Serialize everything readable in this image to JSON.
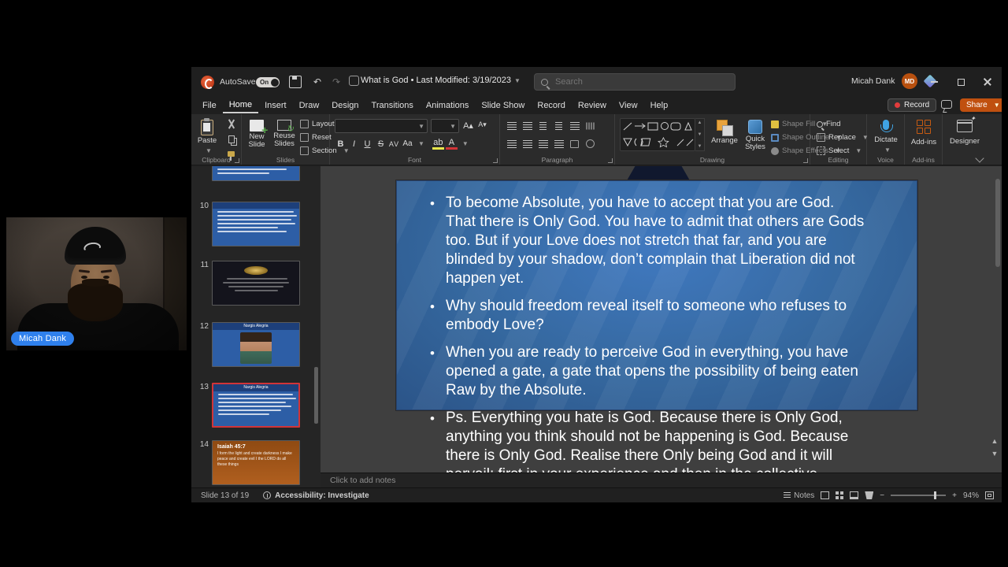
{
  "webcam": {
    "name_tag": "Micah Dank"
  },
  "titlebar": {
    "autosave_label": "AutoSave",
    "autosave_state": "On",
    "title": "What is God • Last Modified: 3/19/2023",
    "search_placeholder": "Search",
    "user_name": "Micah Dank",
    "user_initials": "MD"
  },
  "menubar": {
    "tabs": [
      "File",
      "Home",
      "Insert",
      "Draw",
      "Design",
      "Transitions",
      "Animations",
      "Slide Show",
      "Record",
      "Review",
      "View",
      "Help"
    ],
    "record_button": "Record",
    "share_button": "Share"
  },
  "ribbon": {
    "clipboard": {
      "label": "Clipboard",
      "paste": "Paste"
    },
    "slides": {
      "label": "Slides",
      "new_1": "New",
      "new_2": "Slide",
      "reuse_1": "Reuse",
      "reuse_2": "Slides",
      "layout": "Layout",
      "reset": "Reset",
      "section": "Section"
    },
    "font": {
      "label": "Font",
      "bold": "B",
      "italic": "I",
      "underline": "U",
      "strike": "S",
      "spacing": "AV",
      "case": "Aa",
      "font_name_value": "",
      "font_size_value": ""
    },
    "paragraph": {
      "label": "Paragraph"
    },
    "drawing": {
      "label": "Drawing",
      "arrange": "Arrange",
      "quick_1": "Quick",
      "quick_2": "Styles",
      "shape_fill": "Shape Fill",
      "shape_outline": "Shape Outline",
      "shape_effects": "Shape Effects"
    },
    "editing": {
      "label": "Editing",
      "find": "Find",
      "replace": "Replace",
      "select": "Select"
    },
    "voice": {
      "label": "Voice",
      "dictate": "Dictate"
    },
    "addins": {
      "label": "Add-ins",
      "button": "Add-ins"
    },
    "designer": {
      "label": "Designer"
    }
  },
  "thumbnails": {
    "items": [
      {
        "number": "10"
      },
      {
        "number": "11"
      },
      {
        "number": "12",
        "header": "Nargis Alegria"
      },
      {
        "number": "13",
        "header": "Nargis Alegria"
      },
      {
        "number": "14",
        "title": "Isaiah 45:7",
        "body": "I form the light and create darkness I make peace and create evil I the LORD do all these things"
      }
    ]
  },
  "slide": {
    "bullets": [
      "To become Absolute, you have to accept that you are God. That there is Only God. You have to admit that others are Gods too. But if your Love does not stretch that far, and you are blinded by your shadow, don’t complain that Liberation did not happen yet.",
      "Why should freedom reveal itself to someone who refuses to embody Love?",
      "When you are ready to perceive God in everything, you have opened a gate, a gate that opens the possibility of being eaten Raw by the Absolute.",
      "Ps. Everything you hate is God. Because there is Only God, anything you think should not be happening is God. Because there is Only God. Realise there Only being God and it will pervail; first in your experience and then in the collective."
    ]
  },
  "notes": {
    "placeholder": "Click to add notes"
  },
  "statusbar": {
    "slide_indicator": "Slide 13 of 19",
    "accessibility": "Accessibility: Investigate",
    "notes_label": "Notes",
    "zoom_level": "94%"
  },
  "colors": {
    "share_accent": "#c0500f",
    "selection_red": "#d13438",
    "slide_blue": "#35689f",
    "name_tag_blue": "#2f80ed"
  }
}
